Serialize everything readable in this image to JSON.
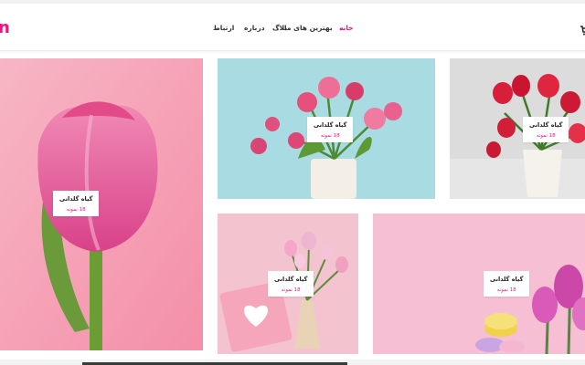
{
  "brand": {
    "logo_fragment": "n",
    "accent": "#e8177f"
  },
  "nav": {
    "items": [
      {
        "label": "خانه",
        "active": true
      },
      {
        "label": "بهترین های ما",
        "active": false
      },
      {
        "label": "بلاگ",
        "active": false
      },
      {
        "label": "درباره",
        "active": false
      },
      {
        "label": "ارتباط",
        "active": false
      }
    ],
    "cart_icon": "cart-icon"
  },
  "products": [
    {
      "name": "گیاه گلدانی",
      "code": "18 نمونه"
    },
    {
      "name": "گیاه گلدانی",
      "code": "18 نمونه"
    },
    {
      "name": "گیاه گلدانی",
      "code": "18 نمونه"
    },
    {
      "name": "گیاه گلدانی",
      "code": "18 نمونه"
    },
    {
      "name": "گیاه گلدانی",
      "code": "18 نمونه"
    }
  ]
}
